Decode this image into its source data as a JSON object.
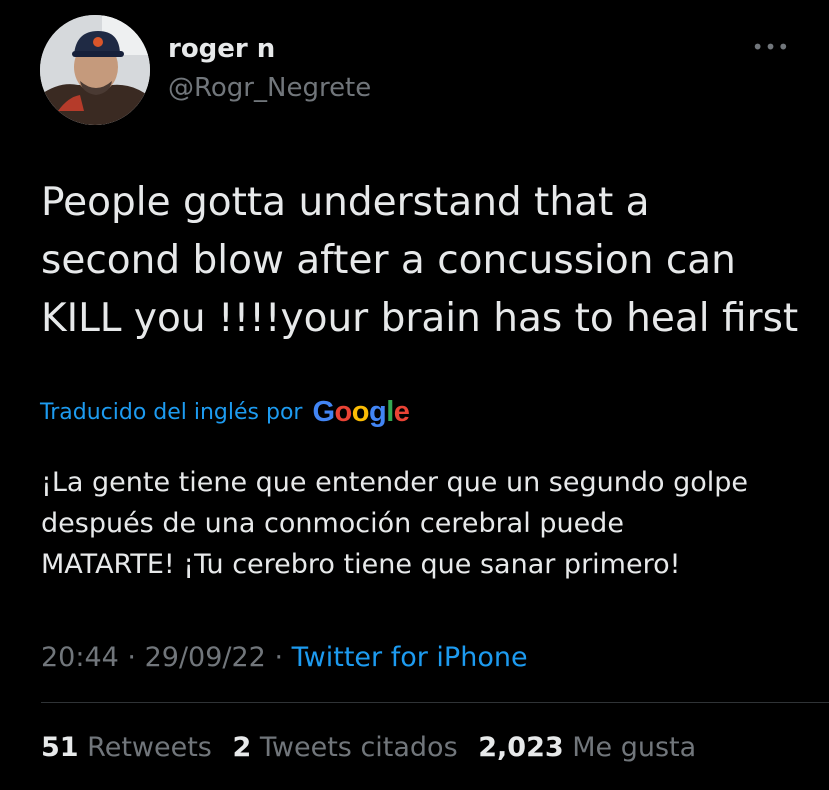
{
  "user": {
    "display_name": "roger n",
    "handle": "@Rogr_Negrete"
  },
  "more_icon": "more-horizontal-icon",
  "tweet": {
    "lines": [
      "People gotta understand that a",
      "second blow after a concussion can",
      "KILL you !!!!your brain has to heal first"
    ]
  },
  "translation": {
    "label": "Traducido del inglés por",
    "provider": [
      "G",
      "o",
      "o",
      "g",
      "l",
      "e"
    ],
    "provider_colors": [
      "#4285f4",
      "#ea4335",
      "#fbbc05",
      "#4285f4",
      "#34a853",
      "#ea4335"
    ],
    "lines": [
      "¡La gente tiene que entender que un segundo golpe",
      "después de una conmoción cerebral puede",
      "MATARTE! ¡Tu cerebro tiene que sanar primero!"
    ]
  },
  "meta": {
    "time": "20:44",
    "separator": "·",
    "date": "29/09/22",
    "source": "Twitter for iPhone"
  },
  "stats": {
    "retweets_count": "51",
    "retweets_label": "Retweets",
    "quotes_count": "2",
    "quotes_label": "Tweets citados",
    "likes_count": "2,023",
    "likes_label": "Me gusta"
  },
  "colors": {
    "background": "#000000",
    "primary_text": "#e7e9ea",
    "secondary_text": "#71767b",
    "link": "#1d9bf0",
    "divider": "#2f3336"
  }
}
